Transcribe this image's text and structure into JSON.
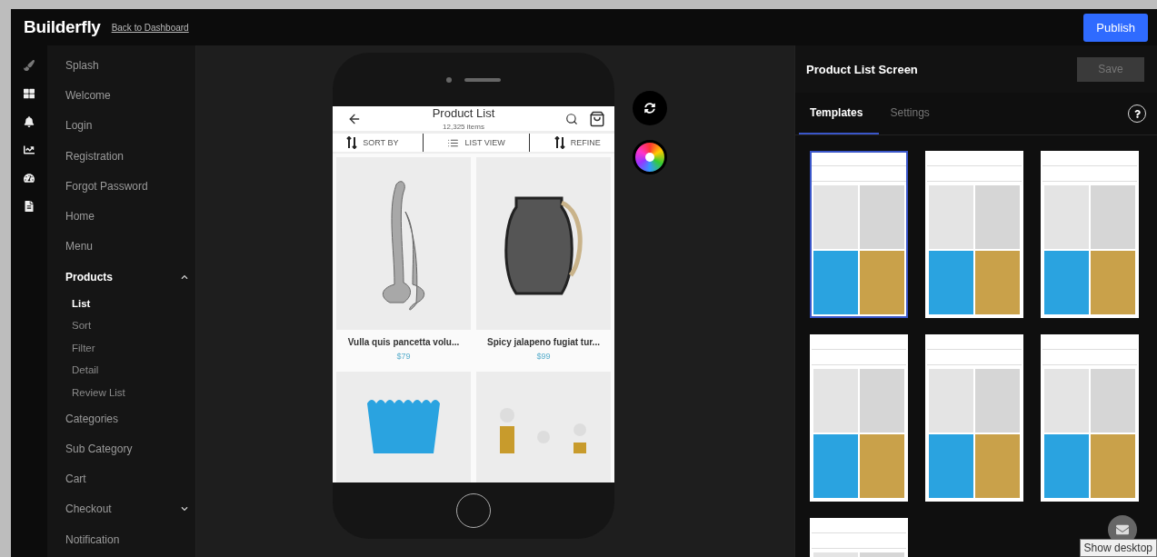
{
  "topbar": {
    "logo": "Builderfly",
    "back_link": "Back to Dashboard",
    "publish": "Publish"
  },
  "rail": [
    {
      "kind": "brush"
    },
    {
      "kind": "grid"
    },
    {
      "kind": "bell"
    },
    {
      "kind": "chart"
    },
    {
      "kind": "gauge"
    },
    {
      "kind": "file"
    }
  ],
  "nav": [
    {
      "label": "Splash"
    },
    {
      "label": "Welcome"
    },
    {
      "label": "Login"
    },
    {
      "label": "Registration"
    },
    {
      "label": "Forgot Password"
    },
    {
      "label": "Home"
    },
    {
      "label": "Menu"
    },
    {
      "label": "Products",
      "expanded": true,
      "children": [
        {
          "label": "List",
          "selected": true
        },
        {
          "label": "Sort",
          "selected": false
        },
        {
          "label": "Filter",
          "selected": false
        },
        {
          "label": "Detail",
          "selected": false
        },
        {
          "label": "Review List",
          "selected": false
        }
      ]
    },
    {
      "label": "Categories"
    },
    {
      "label": "Sub Category"
    },
    {
      "label": "Cart"
    },
    {
      "label": "Checkout",
      "expanded": false
    },
    {
      "label": "Notification"
    }
  ],
  "phone": {
    "title": "Product List",
    "subtitle": "12,325 items",
    "toolbar": [
      {
        "kind": "sort",
        "label": "SORT BY"
      },
      {
        "kind": "list",
        "label": "LIST VIEW"
      },
      {
        "kind": "refine",
        "label": "REFINE"
      }
    ],
    "products": [
      {
        "kind": "swans",
        "name": "Vulla quis pancetta volu...",
        "price": "$79"
      },
      {
        "kind": "lantern",
        "name": "Spicy jalapeno fugiat tur...",
        "price": "$99"
      },
      {
        "kind": "vase"
      },
      {
        "kind": "bottles"
      }
    ]
  },
  "panel": {
    "title": "Product List Screen",
    "save": "Save",
    "tabs": [
      {
        "label": "Templates",
        "selected": true
      },
      {
        "label": "Settings",
        "selected": false
      }
    ],
    "templates": [
      {
        "selected": true
      },
      {
        "selected": false
      },
      {
        "selected": false
      },
      {
        "selected": false
      },
      {
        "selected": false
      },
      {
        "selected": false
      },
      {
        "selected": false
      }
    ]
  },
  "tooltip": "Show desktop"
}
